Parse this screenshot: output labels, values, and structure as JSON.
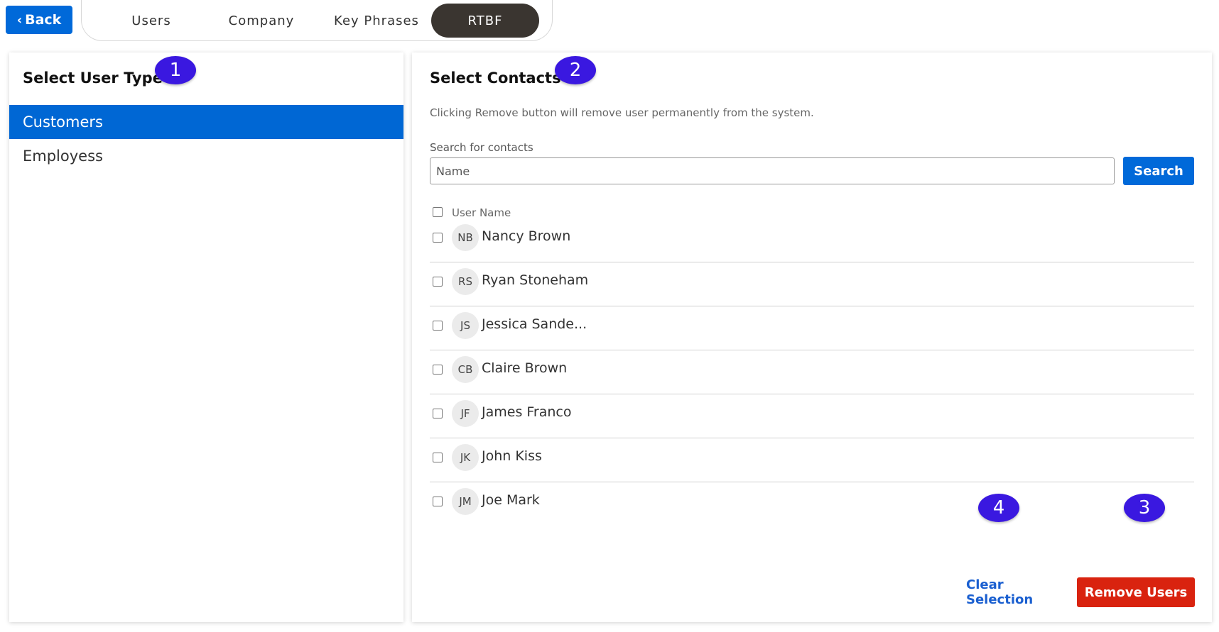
{
  "nav": {
    "back_label": "Back"
  },
  "tabs": [
    {
      "label": "Users",
      "active": false
    },
    {
      "label": "Company",
      "active": false
    },
    {
      "label": "Key Phrases",
      "active": false
    },
    {
      "label": "RTBF",
      "active": true
    }
  ],
  "user_type_panel": {
    "title": "Select User Type",
    "step_badge": "1",
    "items": [
      {
        "label": "Customers",
        "selected": true
      },
      {
        "label": "Employess",
        "selected": false
      }
    ]
  },
  "contacts_panel": {
    "title": "Select Contacts",
    "step_badge": "2",
    "note": "Clicking Remove button will remove user permanently from the system.",
    "search": {
      "label": "Search for contacts",
      "placeholder": "Name",
      "value": "",
      "button_label": "Search"
    },
    "column_header": "User Name",
    "contacts": [
      {
        "initials": "NB",
        "name": "Nancy Brown",
        "checked": false
      },
      {
        "initials": "RS",
        "name": "Ryan Stoneham",
        "checked": false
      },
      {
        "initials": "JS",
        "name": "Jessica Sande...",
        "checked": false
      },
      {
        "initials": "CB",
        "name": "Claire Brown",
        "checked": false
      },
      {
        "initials": "JF",
        "name": "James Franco",
        "checked": false
      },
      {
        "initials": "JK",
        "name": "John Kiss",
        "checked": false
      },
      {
        "initials": "JM",
        "name": "Joe Mark",
        "checked": false
      }
    ],
    "clear_badge": "4",
    "clear_label": "Clear Selection",
    "remove_badge": "3",
    "remove_label": "Remove Users"
  },
  "colors": {
    "primary": "#0069d9",
    "selected_item": "#0067d4",
    "active_tab": "#3a3530",
    "badge": "#3a18e0",
    "danger": "#d9230f",
    "link": "#1a5fd0"
  }
}
